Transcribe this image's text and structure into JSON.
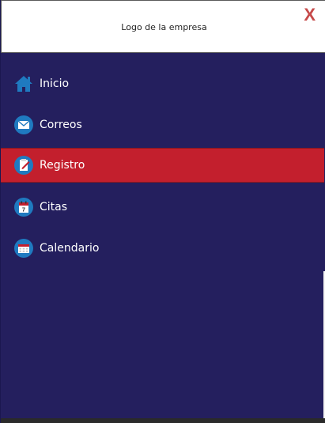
{
  "header": {
    "logo_text": "Logo de la empresa",
    "close_label": "X"
  },
  "menu": {
    "items": [
      {
        "label": "Inicio",
        "icon": "home-icon",
        "active": false
      },
      {
        "label": "Correos",
        "icon": "mail-icon",
        "active": false
      },
      {
        "label": "Registro",
        "icon": "register-icon",
        "active": true
      },
      {
        "label": "Citas",
        "icon": "calendar-7-icon",
        "active": false
      },
      {
        "label": "Calendario",
        "icon": "calendar-grid-icon",
        "active": false
      }
    ]
  },
  "colors": {
    "sidebar_bg": "#241f5e",
    "active_bg": "#c31f2d",
    "icon_blue": "#1f7ac0",
    "close_red": "#c64a4a"
  }
}
